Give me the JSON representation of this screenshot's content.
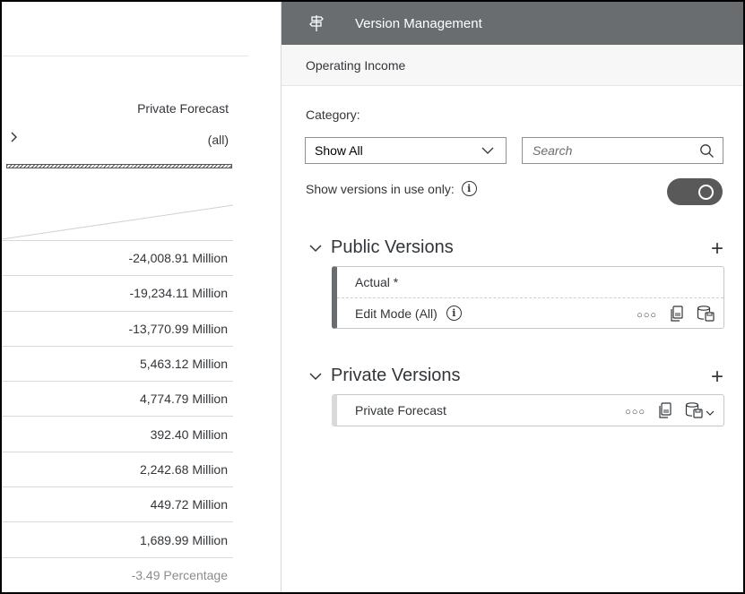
{
  "left_table": {
    "column_header": "Private Forecast",
    "filter_value": "(all)",
    "rows": [
      "-24,008.91 Million",
      "-19,234.11 Million",
      "-13,770.99 Million",
      "5,463.12 Million",
      "4,774.79 Million",
      "392.40 Million",
      "2,242.68 Million",
      "449.72 Million",
      "1,689.99 Million",
      "-3.49 Percentage"
    ]
  },
  "panel": {
    "title": "Version Management",
    "subtitle": "Operating Income",
    "category_label": "Category:",
    "category_value": "Show All",
    "search_placeholder": "Search",
    "show_in_use_label": "Show versions in use only:",
    "toggle_on": true,
    "public": {
      "title": "Public Versions",
      "items": [
        "Actual *",
        "Edit Mode (All)"
      ]
    },
    "private": {
      "title": "Private Versions",
      "items": [
        "Private Forecast"
      ]
    }
  },
  "colors": {
    "header_bg": "#6a6d70",
    "toggle_bg": "#595959",
    "text": "#32363a"
  }
}
